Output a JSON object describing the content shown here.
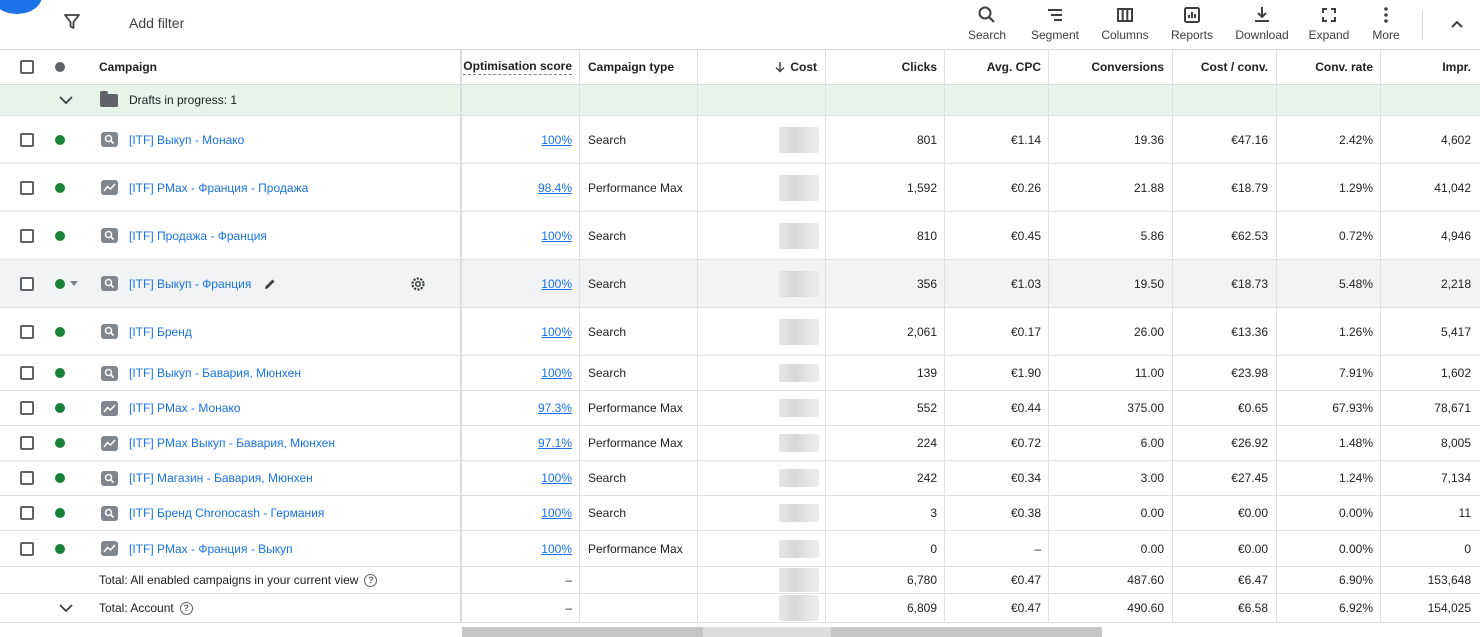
{
  "toolbar": {
    "add_filter": "Add filter",
    "tools": [
      {
        "label": "Search",
        "icon": "search-icon"
      },
      {
        "label": "Segment",
        "icon": "segment-icon"
      },
      {
        "label": "Columns",
        "icon": "columns-icon"
      },
      {
        "label": "Reports",
        "icon": "reports-icon"
      },
      {
        "label": "Download",
        "icon": "download-icon"
      },
      {
        "label": "Expand",
        "icon": "expand-icon"
      },
      {
        "label": "More",
        "icon": "more-icon"
      }
    ]
  },
  "table": {
    "columns": {
      "campaign": "Campaign",
      "optimisation_score": "Optimisation score",
      "campaign_type": "Campaign type",
      "cost": "Cost",
      "clicks": "Clicks",
      "avg_cpc": "Avg. CPC",
      "conversions": "Conversions",
      "cost_per_conv": "Cost / conv.",
      "conv_rate": "Conv. rate",
      "impr": "Impr."
    },
    "drafts_label": "Drafts in progress: 1",
    "rows": [
      {
        "name": "[ITF] Выкуп - Монако",
        "icon": "search",
        "score": "100%",
        "type": "Search",
        "clicks": "801",
        "avg_cpc": "€1.14",
        "conversions": "19.36",
        "cost_conv": "€47.16",
        "conv_rate": "2.42%",
        "impr": "4,602"
      },
      {
        "name": "[ITF] PMax - Франция - Продажа",
        "icon": "pmax",
        "score": "98.4%",
        "type": "Performance Max",
        "clicks": "1,592",
        "avg_cpc": "€0.26",
        "conversions": "21.88",
        "cost_conv": "€18.79",
        "conv_rate": "1.29%",
        "impr": "41,042"
      },
      {
        "name": "[ITF] Продажа - Франция",
        "icon": "search",
        "score": "100%",
        "type": "Search",
        "clicks": "810",
        "avg_cpc": "€0.45",
        "conversions": "5.86",
        "cost_conv": "€62.53",
        "conv_rate": "0.72%",
        "impr": "4,946"
      },
      {
        "name": "[ITF] Выкуп - Франция",
        "icon": "search",
        "score": "100%",
        "type": "Search",
        "clicks": "356",
        "avg_cpc": "€1.03",
        "conversions": "19.50",
        "cost_conv": "€18.73",
        "conv_rate": "5.48%",
        "impr": "2,218"
      },
      {
        "name": "[ITF] Бренд",
        "icon": "search",
        "score": "100%",
        "type": "Search",
        "clicks": "2,061",
        "avg_cpc": "€0.17",
        "conversions": "26.00",
        "cost_conv": "€13.36",
        "conv_rate": "1.26%",
        "impr": "5,417"
      },
      {
        "name": "[ITF] Выкуп - Бавария, Мюнхен",
        "icon": "search",
        "score": "100%",
        "type": "Search",
        "clicks": "139",
        "avg_cpc": "€1.90",
        "conversions": "11.00",
        "cost_conv": "€23.98",
        "conv_rate": "7.91%",
        "impr": "1,602"
      },
      {
        "name": "[ITF] PMax - Монако",
        "icon": "pmax",
        "score": "97.3%",
        "type": "Performance Max",
        "clicks": "552",
        "avg_cpc": "€0.44",
        "conversions": "375.00",
        "cost_conv": "€0.65",
        "conv_rate": "67.93%",
        "impr": "78,671"
      },
      {
        "name": "[ITF] PMax Выкуп - Бавария, Мюнхен",
        "icon": "pmax",
        "score": "97.1%",
        "type": "Performance Max",
        "clicks": "224",
        "avg_cpc": "€0.72",
        "conversions": "6.00",
        "cost_conv": "€26.92",
        "conv_rate": "1.48%",
        "impr": "8,005"
      },
      {
        "name": "[ITF] Магазин - Бавария, Мюнхен",
        "icon": "search",
        "score": "100%",
        "type": "Search",
        "clicks": "242",
        "avg_cpc": "€0.34",
        "conversions": "3.00",
        "cost_conv": "€27.45",
        "conv_rate": "1.24%",
        "impr": "7,134"
      },
      {
        "name": "[ITF] Бренд Chronocash - Германия",
        "icon": "search",
        "score": "100%",
        "type": "Search",
        "clicks": "3",
        "avg_cpc": "€0.38",
        "conversions": "0.00",
        "cost_conv": "€0.00",
        "conv_rate": "0.00%",
        "impr": "11"
      },
      {
        "name": "[ITF] PMax - Франция - Выкуп",
        "icon": "pmax",
        "score": "100%",
        "type": "Performance Max",
        "clicks": "0",
        "avg_cpc": "–",
        "conversions": "0.00",
        "cost_conv": "€0.00",
        "conv_rate": "0.00%",
        "impr": "0"
      }
    ],
    "totals": [
      {
        "label": "Total: All enabled campaigns in your current view",
        "score": "–",
        "clicks": "6,780",
        "avg_cpc": "€0.47",
        "conversions": "487.60",
        "cost_conv": "€6.47",
        "conv_rate": "6.90%",
        "impr": "153,648"
      },
      {
        "label": "Total: Account",
        "score": "–",
        "clicks": "6,809",
        "avg_cpc": "€0.47",
        "conversions": "490.60",
        "cost_conv": "€6.58",
        "conv_rate": "6.92%",
        "impr": "154,025"
      }
    ]
  },
  "colors": {
    "link": "#1a73e8",
    "enabled": "#188038",
    "drafts_bg": "#e6f4ea",
    "hover_row": "#f1f3f4"
  }
}
